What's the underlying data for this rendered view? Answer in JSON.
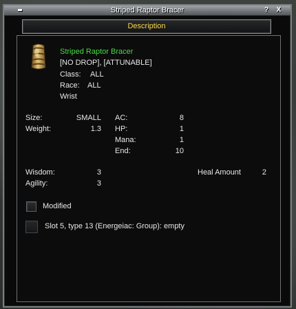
{
  "window": {
    "title": "Striped Raptor Bracer",
    "help_label": "?",
    "close_label": "X"
  },
  "section_title": "Description",
  "item": {
    "icon": "bracer-icon",
    "name": "Striped Raptor Bracer",
    "flags": "[NO DROP], [ATTUNABLE]",
    "class_label": "Class:",
    "class_value": "ALL",
    "race_label": "Race:",
    "race_value": "ALL",
    "slot": "Wrist"
  },
  "stats": {
    "size_label": "Size:",
    "size_value": "SMALL",
    "weight_label": "Weight:",
    "weight_value": "1.3",
    "ac_label": "AC:",
    "ac_value": "8",
    "hp_label": "HP:",
    "hp_value": "1",
    "mana_label": "Mana:",
    "mana_value": "1",
    "end_label": "End:",
    "end_value": "10",
    "wisdom_label": "Wisdom:",
    "wisdom_value": "3",
    "agility_label": "Agility:",
    "agility_value": "3",
    "heal_label": "Heal Amount",
    "heal_value": "2"
  },
  "modified_label": "Modified",
  "modified_checked": false,
  "augment_slot_text": "Slot 5, type 13 (Energeiac: Group): empty",
  "colors": {
    "item_name": "#44dd44",
    "section_title": "#ffd94a",
    "text": "#e8e8e8",
    "window_bg": "#0a0a0a",
    "frame": "#7a7f82"
  }
}
